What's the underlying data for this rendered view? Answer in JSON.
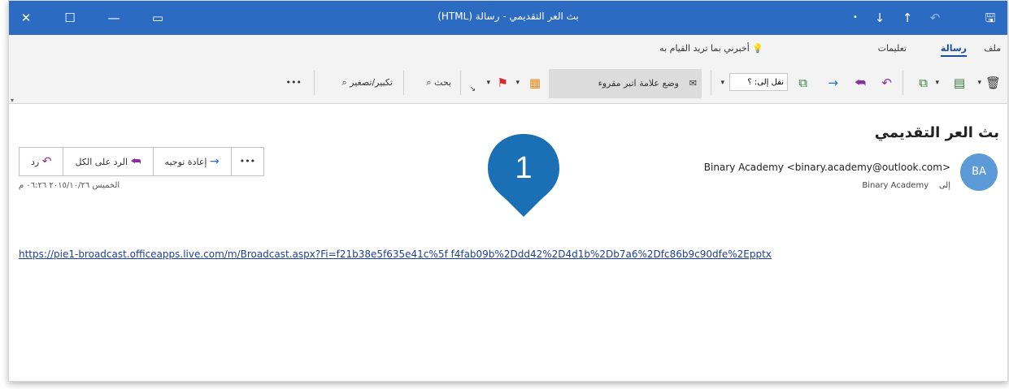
{
  "window": {
    "title": "بث العر التقديمي - رسالة (HTML)"
  },
  "titlebar": {
    "close_glyph": "✕",
    "maximize_glyph": "☐",
    "minimize_glyph": "—",
    "restore_glyph": "▭",
    "save_glyph": "🖫",
    "undo_glyph": "↶",
    "up_glyph": "↑",
    "down_glyph": "↓",
    "dot_glyph": "•"
  },
  "tabs": {
    "file": "ملف",
    "message": "رسالة",
    "help": "تعليمات",
    "tell_me": "أخبرني بما تريد القيام به"
  },
  "ribbon": {
    "move_to": "نقل إلى: ؟",
    "mark_unread": "وضع علامة اتبر مقروء",
    "search": "بحث",
    "zoom": "تكبير/تصغير",
    "more": "•••"
  },
  "message": {
    "subject": "بث العر التقديمي",
    "sender": "Binary Academy <binary.academy@outlook.com>",
    "avatar_initials": "BA",
    "to_label": "إلى",
    "to_value": "Binary Academy",
    "reply": "رد",
    "reply_all": "الرد على الكل",
    "forward": "إعادة توجيه",
    "more": "•••",
    "date": "الخميس ٢٠١٥/١٠/٢٦ ٠٦:٢٦ م",
    "link": "https://pie1-broadcast.officeapps.live.com/m/Broadcast.aspx?Fi=f21b38e5f635e41c%5f f4fab09b%2Ddd42%2D4d1b%2Db7a6%2Dfc86b9c90dfe%2Epptx"
  },
  "callout": {
    "number": "1",
    "color": "#1a6fb5"
  },
  "colors": {
    "titlebar": "#2b6cc2",
    "link": "#1c3f9a",
    "avatar": "#5d9bd8",
    "flag": "#d02a2a"
  }
}
